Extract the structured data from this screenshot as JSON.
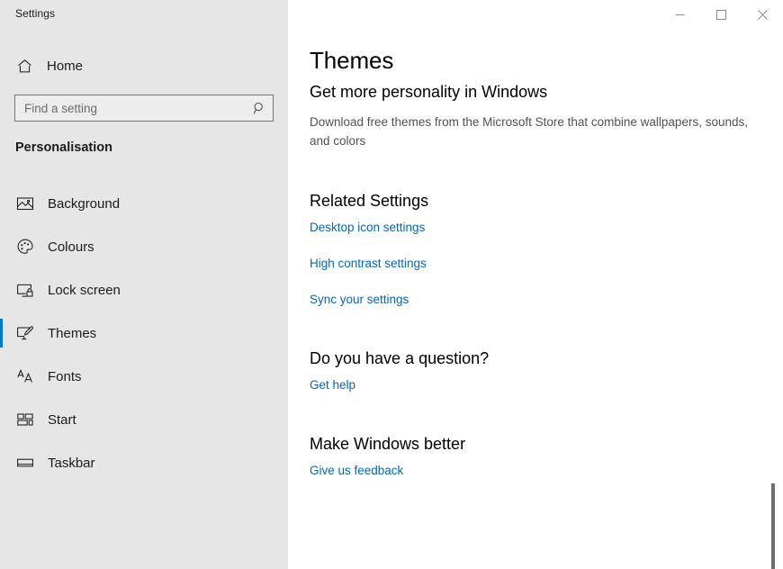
{
  "window": {
    "app_title": "Settings",
    "controls": [
      {
        "name": "minimize",
        "icon": "minimize-icon",
        "label": "Minimise"
      },
      {
        "name": "maximize",
        "icon": "maximize-icon",
        "label": "Maximise"
      },
      {
        "name": "close",
        "icon": "close-icon",
        "label": "Close"
      }
    ]
  },
  "sidebar": {
    "home_label": "Home",
    "home_icon": "home-icon",
    "search": {
      "placeholder": "Find a setting",
      "value": "",
      "icon": "search-icon"
    },
    "section_label": "Personalisation",
    "items": [
      {
        "label": "Background",
        "icon": "image-icon",
        "selected": false
      },
      {
        "label": "Colours",
        "icon": "palette-icon",
        "selected": false
      },
      {
        "label": "Lock screen",
        "icon": "lock-screen-icon",
        "selected": false
      },
      {
        "label": "Themes",
        "icon": "theme-brush-icon",
        "selected": true
      },
      {
        "label": "Fonts",
        "icon": "fonts-aa-icon",
        "selected": false
      },
      {
        "label": "Start",
        "icon": "start-tiles-icon",
        "selected": false
      },
      {
        "label": "Taskbar",
        "icon": "taskbar-icon",
        "selected": false
      }
    ]
  },
  "main": {
    "page_title": "Themes",
    "promo": {
      "heading": "Get more personality in Windows",
      "description": "Download free themes from the Microsoft Store that combine wallpapers, sounds, and colors"
    },
    "related_settings": {
      "heading": "Related Settings",
      "links": [
        "Desktop icon settings",
        "High contrast settings",
        "Sync your settings"
      ]
    },
    "question": {
      "heading": "Do you have a question?",
      "links": [
        "Get help"
      ]
    },
    "feedback": {
      "heading": "Make Windows better",
      "links": [
        "Give us feedback"
      ]
    }
  },
  "colors": {
    "accent": "#0078d7",
    "link": "#0067c0",
    "sidebar_bg": "#e6e6e6",
    "content_bg": "#ffffff",
    "text": "#1b1b1b",
    "muted_text": "#515151"
  }
}
